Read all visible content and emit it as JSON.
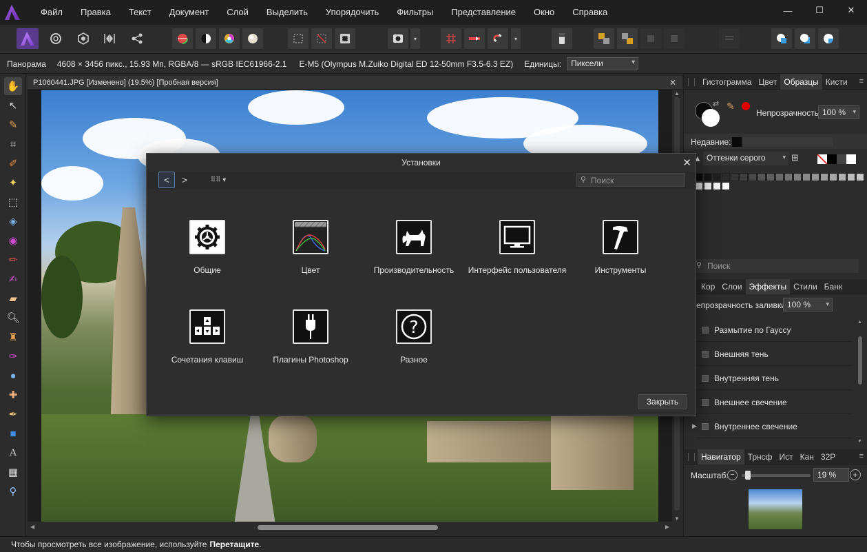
{
  "menu": [
    "Файл",
    "Правка",
    "Текст",
    "Документ",
    "Слой",
    "Выделить",
    "Упорядочить",
    "Фильтры",
    "Представление",
    "Окно",
    "Справка"
  ],
  "context_bar": {
    "mode": "Панорама",
    "info": "4608 × 3456 пикс., 15.93 Мп, RGBA/8 — sRGB IEC61966-2.1",
    "camera": "E-M5 (Olympus M.Zuiko Digital ED 12-50mm F3.5-6.3 EZ)",
    "units_label": "Единицы:",
    "units_value": "Пиксели"
  },
  "document": {
    "tab_title": "P1060441.JPG [Изменено] (19.5%) [Пробная версия]"
  },
  "status_bar": {
    "text": "Чтобы просмотреть все изображение, используйте",
    "bold": "Перетащите",
    "suffix": "."
  },
  "panels": {
    "top_tabs": [
      "Гистограмма",
      "Цвет",
      "Образцы",
      "Кисти"
    ],
    "top_active": "Образцы",
    "opacity_label": "Непрозрачность:",
    "opacity_value": "100 %",
    "recent_label": "Недавние:",
    "palette_select": "Оттенки серого",
    "search_placeholder": "Поиск",
    "mid_tabs": [
      "Кор",
      "Слои",
      "Эффекты",
      "Стили",
      "Банк"
    ],
    "mid_active": "Эффекты",
    "fill_opacity_label": "епрозрачность заливки:",
    "fill_opacity_value": "100 %",
    "effects": [
      "Размытие по Гауссу",
      "Внешняя тень",
      "Внутренняя тень",
      "Внешнее свечение",
      "Внутреннее свечение"
    ],
    "bottom_tabs": [
      "Навигатор",
      "Трнсф",
      "Ист",
      "Кан",
      "32Р"
    ],
    "bottom_active": "Навигатор",
    "zoom_label": "Масштаб:",
    "zoom_value": "19 %"
  },
  "dialog": {
    "title": "Установки",
    "search_placeholder": "Поиск",
    "items": [
      {
        "label": "Общие",
        "icon": "gear-icon"
      },
      {
        "label": "Цвет",
        "icon": "color-icon"
      },
      {
        "label": "Производительность",
        "icon": "cat-icon"
      },
      {
        "label": "Интерфейс пользователя",
        "icon": "monitor-icon"
      },
      {
        "label": "Инструменты",
        "icon": "hammer-icon"
      },
      {
        "label": "Сочетания клавиш",
        "icon": "keyboard-icon"
      },
      {
        "label": "Плагины Photoshop",
        "icon": "plug-icon"
      },
      {
        "label": "Разное",
        "icon": "question-icon"
      }
    ],
    "close_label": "Закрыть"
  }
}
